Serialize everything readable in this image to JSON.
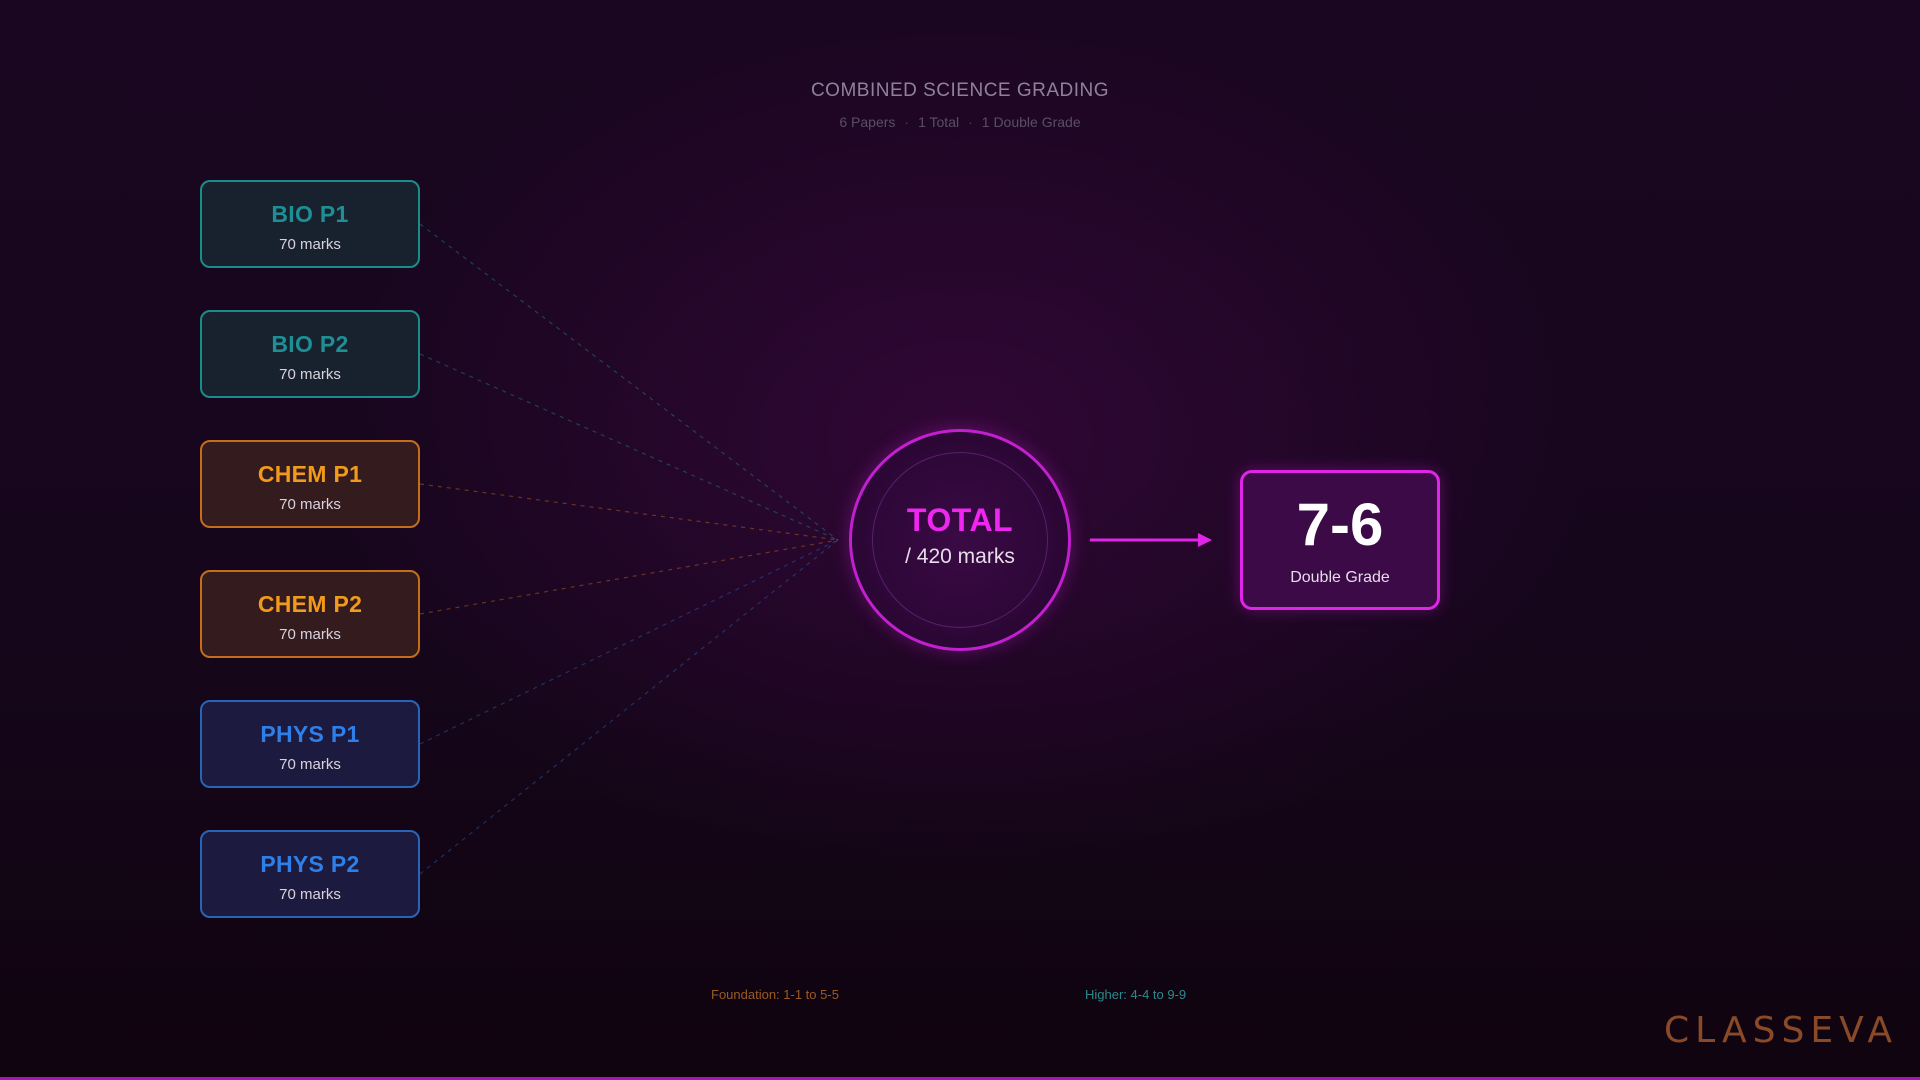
{
  "header": {
    "title": "COMBINED SCIENCE GRADING",
    "subtitle_parts": [
      "6 Papers",
      "1 Total",
      "1 Double Grade"
    ],
    "separator": "·"
  },
  "papers": [
    {
      "name": "BIO P1",
      "marks": "70 marks",
      "subject": "biology",
      "color": "#1f8f96",
      "border": "#1c8c8a",
      "bg": "#18222e"
    },
    {
      "name": "BIO P2",
      "marks": "70 marks",
      "subject": "biology",
      "color": "#1f8f96",
      "border": "#1c8c8a",
      "bg": "#18222e"
    },
    {
      "name": "CHEM P1",
      "marks": "70 marks",
      "subject": "chemistry",
      "color": "#f29a1c",
      "border": "#c46d1c",
      "bg": "#341c1e"
    },
    {
      "name": "CHEM P2",
      "marks": "70 marks",
      "subject": "chemistry",
      "color": "#f29a1c",
      "border": "#c46d1c",
      "bg": "#341c1e"
    },
    {
      "name": "PHYS P1",
      "marks": "70 marks",
      "subject": "physics",
      "color": "#2f7fe8",
      "border": "#2865b8",
      "bg": "#1c1a3e"
    },
    {
      "name": "PHYS P2",
      "marks": "70 marks",
      "subject": "physics",
      "color": "#2f7fe8",
      "border": "#2865b8",
      "bg": "#1c1a3e"
    }
  ],
  "total": {
    "label": "TOTAL",
    "marks": "/ 420 marks",
    "color": "#ef25f0"
  },
  "result": {
    "grade": "7-6",
    "label": "Double Grade",
    "color": "#e025e8"
  },
  "legend": {
    "foundation": "Foundation: 1-1 to 5-5",
    "higher": "Higher: 4-4 to 9-9",
    "foundation_color": "#9a5a22",
    "higher_color": "#2a8a8a"
  },
  "brand": {
    "logo_text": "CLASSEVA",
    "logo_color": "#8a4a28"
  }
}
